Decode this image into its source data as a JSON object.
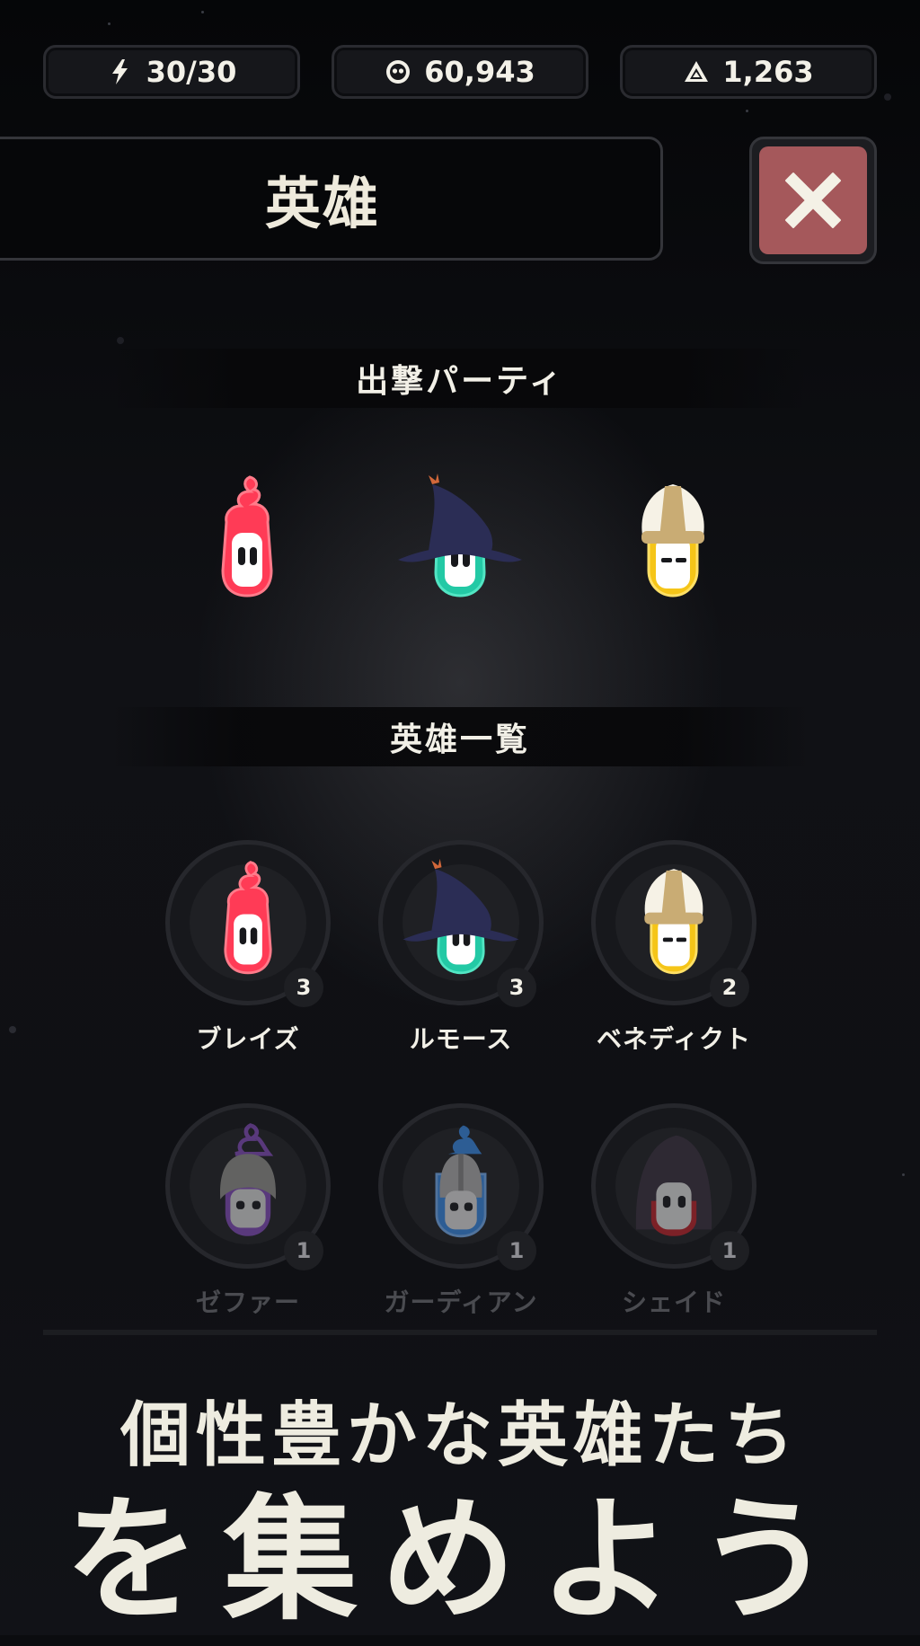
{
  "currency": {
    "energy": {
      "icon": "lightning-icon",
      "value": "30/30"
    },
    "coins": {
      "icon": "skull-coin-icon",
      "value": "60,943"
    },
    "crystals": {
      "icon": "triangle-crystal-icon",
      "value": "1,263"
    }
  },
  "header": {
    "title": "英雄",
    "close_icon": "close-icon"
  },
  "party": {
    "heading": "出撃パーティ",
    "members": [
      {
        "hero": "ブレイズ",
        "color": "#ff3b56"
      },
      {
        "hero": "ルモース",
        "color": "#23c9a5"
      },
      {
        "hero": "ベネディクト",
        "color": "#f5c518"
      }
    ]
  },
  "hero_list": {
    "heading": "英雄一覧",
    "heroes": [
      {
        "name": "ブレイズ",
        "count": "3",
        "color": "#ff3b56",
        "locked": false
      },
      {
        "name": "ルモース",
        "count": "3",
        "color": "#23c9a5",
        "locked": false
      },
      {
        "name": "ベネディクト",
        "count": "2",
        "color": "#f5c518",
        "locked": false
      },
      {
        "name": "ゼファー",
        "count": "1",
        "color": "#8a4fc4",
        "locked": true
      },
      {
        "name": "ガーディアン",
        "count": "1",
        "color": "#3a8ff0",
        "locked": true
      },
      {
        "name": "シェイド",
        "count": "1",
        "color": "#c8222a",
        "locked": true
      }
    ]
  },
  "promo": {
    "line1": "個性豊かな英雄たち",
    "line2": "を集めよう"
  }
}
